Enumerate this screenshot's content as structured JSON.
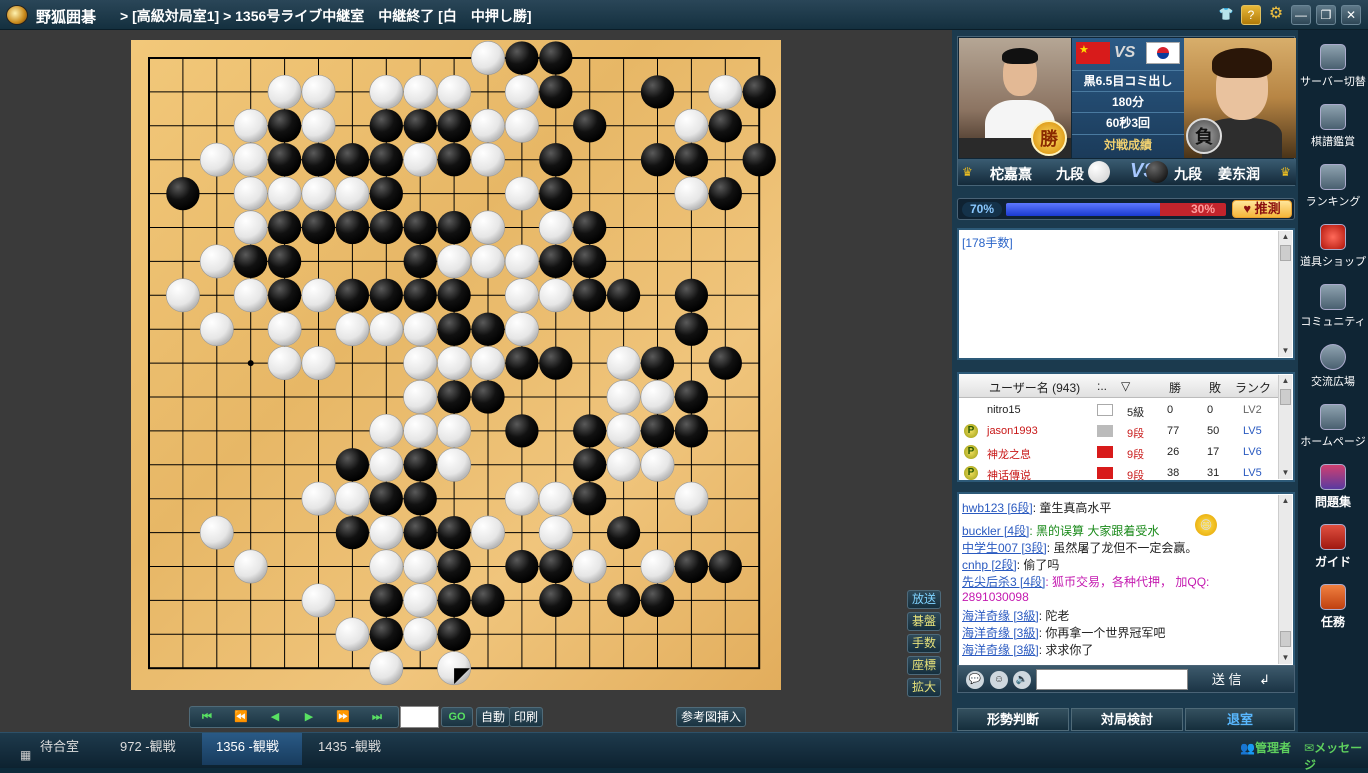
{
  "window": {
    "app_name": "野狐囲碁",
    "room_title": "> [高級対局室1] > 1356号ライブ中継室　中継終了 [白　中押し勝]"
  },
  "title_buttons": [
    {
      "icon": "shirt-icon",
      "glyph": "👕"
    },
    {
      "icon": "help-icon",
      "glyph": "?"
    },
    {
      "icon": "gear-icon",
      "glyph": "⚙"
    },
    {
      "icon": "minimize-icon",
      "glyph": "—"
    },
    {
      "icon": "restore-icon",
      "glyph": "❐"
    },
    {
      "icon": "close-icon",
      "glyph": "✕"
    }
  ],
  "board": {
    "size": 19,
    "last_move": [
      18,
      9
    ],
    "black": [
      [
        0,
        11
      ],
      [
        0,
        12
      ],
      [
        1,
        12
      ],
      [
        1,
        15
      ],
      [
        1,
        18
      ],
      [
        2,
        4
      ],
      [
        2,
        7
      ],
      [
        2,
        8
      ],
      [
        2,
        9
      ],
      [
        2,
        13
      ],
      [
        2,
        17
      ],
      [
        3,
        4
      ],
      [
        3,
        5
      ],
      [
        3,
        6
      ],
      [
        3,
        7
      ],
      [
        3,
        9
      ],
      [
        3,
        12
      ],
      [
        3,
        15
      ],
      [
        3,
        16
      ],
      [
        3,
        18
      ],
      [
        4,
        1
      ],
      [
        4,
        7
      ],
      [
        4,
        12
      ],
      [
        4,
        17
      ],
      [
        5,
        4
      ],
      [
        5,
        5
      ],
      [
        5,
        6
      ],
      [
        5,
        7
      ],
      [
        5,
        8
      ],
      [
        5,
        9
      ],
      [
        5,
        13
      ],
      [
        6,
        2
      ],
      [
        6,
        3
      ],
      [
        6,
        4
      ],
      [
        6,
        8
      ],
      [
        6,
        12
      ],
      [
        6,
        13
      ],
      [
        7,
        4
      ],
      [
        7,
        6
      ],
      [
        7,
        7
      ],
      [
        7,
        8
      ],
      [
        7,
        9
      ],
      [
        7,
        13
      ],
      [
        7,
        14
      ],
      [
        7,
        16
      ],
      [
        8,
        9
      ],
      [
        8,
        10
      ],
      [
        8,
        16
      ],
      [
        9,
        11
      ],
      [
        9,
        12
      ],
      [
        9,
        15
      ],
      [
        9,
        17
      ],
      [
        10,
        9
      ],
      [
        10,
        10
      ],
      [
        10,
        16
      ],
      [
        11,
        11
      ],
      [
        11,
        13
      ],
      [
        11,
        15
      ],
      [
        11,
        16
      ],
      [
        12,
        6
      ],
      [
        12,
        8
      ],
      [
        12,
        13
      ],
      [
        13,
        7
      ],
      [
        13,
        8
      ],
      [
        13,
        13
      ],
      [
        14,
        6
      ],
      [
        14,
        8
      ],
      [
        14,
        9
      ],
      [
        14,
        14
      ],
      [
        15,
        9
      ],
      [
        15,
        11
      ],
      [
        15,
        12
      ],
      [
        15,
        16
      ],
      [
        15,
        17
      ],
      [
        16,
        7
      ],
      [
        16,
        9
      ],
      [
        16,
        10
      ],
      [
        16,
        12
      ],
      [
        16,
        14
      ],
      [
        16,
        15
      ],
      [
        17,
        7
      ],
      [
        17,
        9
      ]
    ],
    "white": [
      [
        0,
        10
      ],
      [
        1,
        4
      ],
      [
        1,
        5
      ],
      [
        1,
        7
      ],
      [
        1,
        8
      ],
      [
        1,
        9
      ],
      [
        1,
        11
      ],
      [
        1,
        17
      ],
      [
        2,
        3
      ],
      [
        2,
        5
      ],
      [
        2,
        10
      ],
      [
        2,
        11
      ],
      [
        2,
        16
      ],
      [
        3,
        2
      ],
      [
        3,
        3
      ],
      [
        3,
        8
      ],
      [
        3,
        10
      ],
      [
        4,
        3
      ],
      [
        4,
        4
      ],
      [
        4,
        5
      ],
      [
        4,
        6
      ],
      [
        4,
        11
      ],
      [
        4,
        16
      ],
      [
        5,
        3
      ],
      [
        5,
        10
      ],
      [
        5,
        12
      ],
      [
        6,
        2
      ],
      [
        6,
        9
      ],
      [
        6,
        10
      ],
      [
        6,
        11
      ],
      [
        7,
        1
      ],
      [
        7,
        3
      ],
      [
        7,
        5
      ],
      [
        7,
        11
      ],
      [
        7,
        12
      ],
      [
        8,
        2
      ],
      [
        8,
        4
      ],
      [
        8,
        6
      ],
      [
        8,
        7
      ],
      [
        8,
        8
      ],
      [
        8,
        11
      ],
      [
        9,
        4
      ],
      [
        9,
        5
      ],
      [
        9,
        8
      ],
      [
        9,
        9
      ],
      [
        9,
        10
      ],
      [
        9,
        14
      ],
      [
        10,
        8
      ],
      [
        10,
        14
      ],
      [
        10,
        15
      ],
      [
        11,
        7
      ],
      [
        11,
        8
      ],
      [
        11,
        9
      ],
      [
        11,
        14
      ],
      [
        12,
        7
      ],
      [
        12,
        9
      ],
      [
        12,
        14
      ],
      [
        12,
        15
      ],
      [
        13,
        5
      ],
      [
        13,
        6
      ],
      [
        13,
        11
      ],
      [
        13,
        12
      ],
      [
        13,
        16
      ],
      [
        14,
        2
      ],
      [
        14,
        7
      ],
      [
        14,
        10
      ],
      [
        14,
        12
      ],
      [
        15,
        3
      ],
      [
        15,
        7
      ],
      [
        15,
        8
      ],
      [
        15,
        13
      ],
      [
        15,
        15
      ],
      [
        16,
        5
      ],
      [
        16,
        8
      ],
      [
        17,
        6
      ],
      [
        17,
        8
      ],
      [
        18,
        7
      ],
      [
        18,
        9
      ]
    ]
  },
  "side_buttons": [
    "放送",
    "碁盤",
    "手数",
    "座標",
    "拡大"
  ],
  "nav": {
    "buttons": [
      "⏮",
      "⏪",
      "◀",
      "▶",
      "⏩",
      "⏭"
    ],
    "go": "GO",
    "auto": "自動",
    "print": "印刷",
    "insert_diagram": "参考図挿入"
  },
  "match": {
    "komi": "黒6.5目コミ出し",
    "time": "180分",
    "byoyomi": "60秒3回",
    "record_label": "対戦成績",
    "vs": "VS",
    "win_mark": "勝",
    "lose_mark": "負"
  },
  "players": {
    "left_name": "柁嘉熹",
    "left_rank": "九段",
    "right_rank": "九段",
    "right_name": "姜东润"
  },
  "prediction": {
    "white_pct_label": "70%",
    "white_pct": 70,
    "black_pct_label": "30%",
    "button": "推測"
  },
  "comment": {
    "text": "[178手数]"
  },
  "users": {
    "header": {
      "name": "ユーザー名 (943)",
      "col2": ":..",
      "win": "勝",
      "loss": "敗",
      "rank": "ランク"
    },
    "rows": [
      {
        "name": "nitro15",
        "flag": "jp",
        "rank": "5級",
        "win": "0",
        "loss": "0",
        "lv": "LV2",
        "p": false
      },
      {
        "name": "jason1993",
        "flag": "other",
        "rank": "9段",
        "win": "77",
        "loss": "50",
        "lv": "LV5",
        "p": true
      },
      {
        "name": "神龙之息",
        "flag": "cn",
        "rank": "9段",
        "win": "26",
        "loss": "17",
        "lv": "LV6",
        "p": true
      },
      {
        "name": "神话傳说",
        "flag": "cn",
        "rank": "9段",
        "win": "38",
        "loss": "31",
        "lv": "LV5",
        "p": true
      }
    ]
  },
  "chat": [
    {
      "name": "hwb123 [6段]",
      "msg": ": 童生真高水平",
      "color": "#222"
    },
    {
      "name": "buckler [4段]",
      "msg": ": 黑的误算  大家跟着受水",
      "color": "#1a8a1a"
    },
    {
      "name": "中学生007 [3段]",
      "msg": ": 虽然屠了龙但不一定会赢。",
      "color": "#222"
    },
    {
      "name": "cnhp [2段]",
      "msg": ": 偷了吗",
      "color": "#222"
    },
    {
      "name": "先尖后杀3 [4段]",
      "msg": ": 狐币交易，各种代押， 加QQ:",
      "color": "#c41ab0"
    },
    {
      "name": "",
      "msg": "2891030098",
      "color": "#c41ab0"
    },
    {
      "name": "海洋奇缘 [3級]",
      "msg": ": 陀老",
      "color": "#222"
    },
    {
      "name": "海洋奇缘 [3級]",
      "msg": ": 你再拿一个世界冠军吧",
      "color": "#222"
    },
    {
      "name": "海洋奇缘 [3級]",
      "msg": ": 求求你了",
      "color": "#222"
    }
  ],
  "chat_input": {
    "send": "送 信"
  },
  "bottom_buttons": [
    "形勢判断",
    "対局検討",
    "退室"
  ],
  "sidebar": [
    "サーバー切替",
    "棋譜鑑賞",
    "ランキング",
    "道具ショップ",
    "コミュニティ",
    "交流広場",
    "ホームページ",
    "問題集",
    "ガイド",
    "任務"
  ],
  "taskbar": {
    "tabs": [
      "待合室",
      "972 -観戦",
      "1356 -観戦",
      "1435 -観戦"
    ],
    "admin": "管理者",
    "message": "メッセージ"
  }
}
